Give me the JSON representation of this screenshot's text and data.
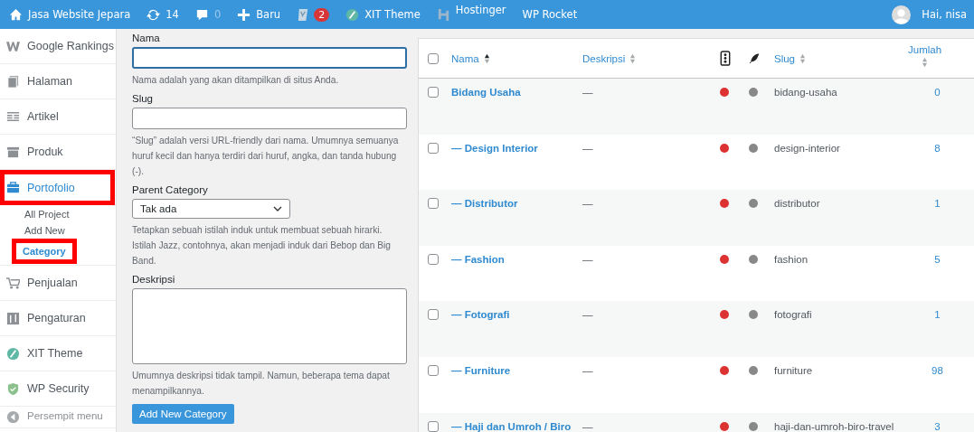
{
  "admin_bar": {
    "items": [
      {
        "kind": "site",
        "label": "Jasa Website Jepara"
      },
      {
        "kind": "updates",
        "label": "14"
      },
      {
        "kind": "comments",
        "label": "0"
      },
      {
        "kind": "new",
        "label": "Baru"
      },
      {
        "kind": "seo",
        "label": "2"
      },
      {
        "kind": "theme",
        "label": "XIT Theme"
      },
      {
        "kind": "hosting",
        "label": "Hostinger"
      },
      {
        "kind": "plugin",
        "label": "WP Rocket"
      }
    ],
    "user": "Hai, nisa"
  },
  "sidebar": {
    "items": [
      {
        "kind": "rankings",
        "label": "Google Rankings",
        "selected": false,
        "highlighted": false
      },
      {
        "kind": "pages",
        "label": "Halaman",
        "selected": false,
        "highlighted": false
      },
      {
        "kind": "posts",
        "label": "Artikel",
        "selected": false,
        "highlighted": false
      },
      {
        "kind": "products",
        "label": "Produk",
        "selected": false,
        "highlighted": false
      },
      {
        "kind": "portfolio",
        "label": "Portofolio",
        "selected": true,
        "highlighted": true,
        "children": [
          {
            "label": "All Project",
            "selected": false,
            "highlighted": false
          },
          {
            "label": "Add New",
            "selected": false,
            "highlighted": false
          },
          {
            "label": "Category",
            "selected": true,
            "highlighted": true
          }
        ]
      },
      {
        "kind": "sales",
        "label": "Penjualan",
        "selected": false,
        "highlighted": false
      },
      {
        "kind": "settings",
        "label": "Pengaturan",
        "selected": false,
        "highlighted": false
      },
      {
        "kind": "theme",
        "label": "XIT Theme",
        "selected": false,
        "highlighted": false
      },
      {
        "kind": "security",
        "label": "WP Security",
        "selected": false,
        "highlighted": false
      },
      {
        "kind": "collapse",
        "label": "Persempit menu",
        "selected": false,
        "highlighted": false
      }
    ]
  },
  "form": {
    "fields": [
      {
        "kind": "text",
        "label": "Nama",
        "focused": true,
        "help": "Nama adalah yang akan ditampilkan di situs Anda."
      },
      {
        "kind": "text",
        "label": "Slug",
        "focused": false,
        "help": "“Slug” adalah versi URL-friendly dari nama. Umumnya semuanya huruf kecil dan hanya terdiri dari huruf, angka, dan tanda hubung (-)."
      },
      {
        "kind": "select",
        "label": "Parent Category",
        "value": "Tak ada",
        "help": "Tetapkan sebuah istilah induk untuk membuat sebuah hirarki. Istilah Jazz, contohnya, akan menjadi induk dari Bebop dan Big Band."
      },
      {
        "kind": "textarea",
        "label": "Deskripsi",
        "focused": false,
        "help": "Umumnya deskripsi tidak tampil. Namun, beberapa tema dapat menampilkannya."
      }
    ],
    "submit": "Add New Category"
  },
  "table": {
    "select_all_checked": false,
    "columns": [
      {
        "kind": "check"
      },
      {
        "kind": "sort",
        "label": "Nama",
        "sorted": true
      },
      {
        "kind": "sort",
        "label": "Deskripsi",
        "sorted": false
      },
      {
        "kind": "seo-icon"
      },
      {
        "kind": "read-icon"
      },
      {
        "kind": "sort",
        "label": "Slug",
        "sorted": false
      },
      {
        "kind": "sort-stack",
        "label": "Jumlah",
        "sorted": false
      }
    ],
    "rows": [
      {
        "name": "Bidang Usaha",
        "description": "—",
        "seo": {
          "color": "#dc3232"
        },
        "readability": {
          "color": "#888888"
        },
        "slug": "bidang-usaha",
        "count": "0",
        "checked": false
      },
      {
        "name": "— Design Interior",
        "description": "—",
        "seo": {
          "color": "#dc3232"
        },
        "readability": {
          "color": "#888888"
        },
        "slug": "design-interior",
        "count": "8",
        "checked": false
      },
      {
        "name": "— Distributor",
        "description": "—",
        "seo": {
          "color": "#dc3232"
        },
        "readability": {
          "color": "#888888"
        },
        "slug": "distributor",
        "count": "1",
        "checked": false
      },
      {
        "name": "— Fashion",
        "description": "—",
        "seo": {
          "color": "#dc3232"
        },
        "readability": {
          "color": "#888888"
        },
        "slug": "fashion",
        "count": "5",
        "checked": false
      },
      {
        "name": "— Fotografi",
        "description": "—",
        "seo": {
          "color": "#dc3232"
        },
        "readability": {
          "color": "#888888"
        },
        "slug": "fotografi",
        "count": "1",
        "checked": false
      },
      {
        "name": "— Furniture",
        "description": "—",
        "seo": {
          "color": "#dc3232"
        },
        "readability": {
          "color": "#888888"
        },
        "slug": "furniture",
        "count": "98",
        "checked": false
      },
      {
        "name": "— Haji dan Umroh / Biro",
        "description": "—",
        "seo": {
          "color": "#dc3232"
        },
        "readability": {
          "color": "#888888"
        },
        "slug": "haji-dan-umroh-biro-travel",
        "count": "3",
        "checked": false
      }
    ]
  }
}
